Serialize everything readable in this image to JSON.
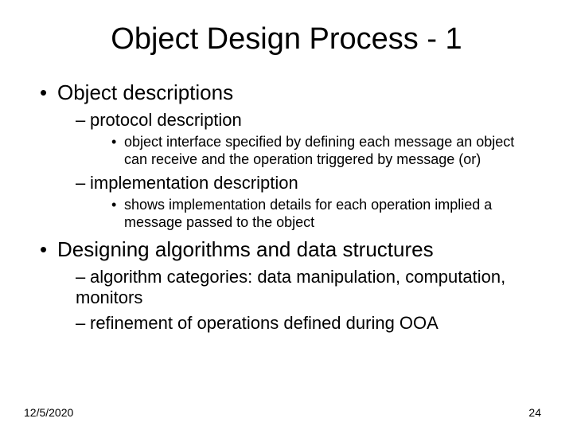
{
  "title": "Object Design Process - 1",
  "b1a": "Object descriptions",
  "b2a": "protocol description",
  "b3a": "object interface specified by defining each message an object can receive and the operation triggered by message (or)",
  "b2b": "implementation description",
  "b3b": "shows implementation details for each operation implied a message passed to the object",
  "b1b": "Designing algorithms and data structures",
  "b2c": "algorithm categories: data manipulation, computation, monitors",
  "b2d": "refinement of operations defined during OOA",
  "date": "12/5/2020",
  "page": "24"
}
